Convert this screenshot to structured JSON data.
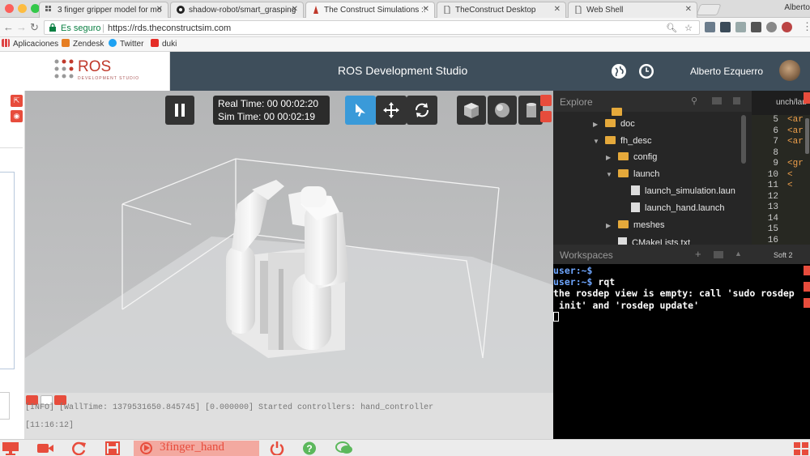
{
  "browser": {
    "tabs": [
      {
        "title": "3 finger gripper model for mo"
      },
      {
        "title": "shadow-robot/smart_grasping"
      },
      {
        "title": "The Construct Simulations ::"
      },
      {
        "title": "TheConstruct Desktop"
      },
      {
        "title": "Web Shell"
      }
    ],
    "profile_name": "Alberto",
    "secure_label": "Es seguro",
    "url": "https://rds.theconstructsim.com",
    "bookmarks": [
      {
        "label": "Aplicaciones"
      },
      {
        "label": "Zendesk"
      },
      {
        "label": "Twitter"
      },
      {
        "label": "duki"
      }
    ]
  },
  "header": {
    "logo_text": "ROS",
    "logo_sub": "DEVELOPMENT STUDIO",
    "title": "ROS Development Studio",
    "user_name": "Alberto Ezquerro"
  },
  "simulation": {
    "real_time_label": "Real Time: 00 00:02:20",
    "sim_time_label": "Sim Time: 00 00:02:19"
  },
  "log": {
    "line1": "[INFO] [WallTime: 1379531650.845745] [0.000000] Started controllers: hand_controller",
    "line2": "[11:16:12]"
  },
  "explorer": {
    "title": "Explore",
    "items": [
      {
        "label": "doc",
        "type": "folder"
      },
      {
        "label": "fh_desc",
        "type": "folder"
      },
      {
        "label": "config",
        "type": "folder"
      },
      {
        "label": "launch",
        "type": "folder"
      },
      {
        "label": "launch_simulation.laun",
        "type": "file"
      },
      {
        "label": "launch_hand.launch",
        "type": "file"
      },
      {
        "label": "meshes",
        "type": "folder"
      },
      {
        "label": "CMakeLists.txt",
        "type": "file"
      }
    ]
  },
  "editor": {
    "tab_label": "unch/lau",
    "line_numbers": [
      "5",
      "6",
      "7",
      "8",
      "9",
      "10",
      "11",
      "12",
      "13",
      "14",
      "15",
      "16"
    ],
    "code": [
      "<ar",
      "<ar",
      "<ar",
      "",
      "<gr",
      "<",
      "<",
      "",
      "",
      "",
      "",
      ""
    ],
    "status": "Soft 2"
  },
  "workspaces": {
    "title": "Workspaces"
  },
  "terminal": {
    "line1_prompt": "user:~$",
    "line2_prompt": "user:~$",
    "line2_cmd": " rqt",
    "line3": "the rosdep view is empty: call 'sudo rosdep",
    "line4": " init' and 'rosdep update'"
  },
  "bottombar": {
    "launch_label": "3finger_hand"
  }
}
